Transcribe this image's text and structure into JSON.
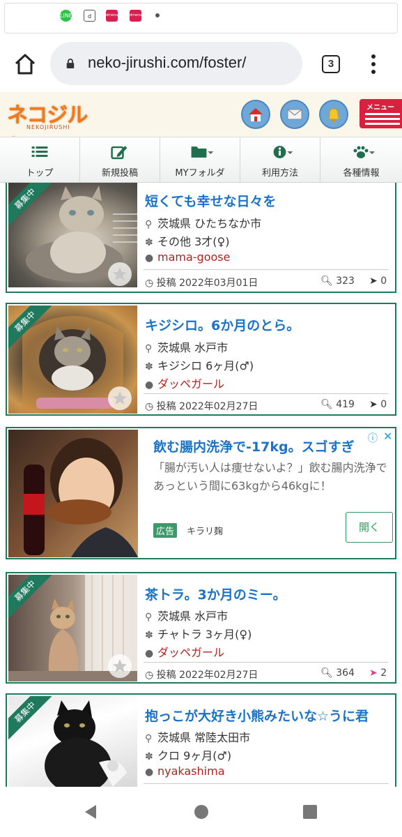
{
  "browser": {
    "url": "neko-jirushi.com/foster/",
    "tab_count": "3"
  },
  "statusbar": {
    "icons": [
      "LINE",
      "d",
      "dmenu",
      "dmenu"
    ]
  },
  "site": {
    "logo_text": "ネコジルシ",
    "logo_sub": "NEKOJIRUSHI",
    "menu_label": "メニュー"
  },
  "nav": {
    "items": [
      {
        "label": "トップ",
        "icon": "list-icon"
      },
      {
        "label": "新規投稿",
        "icon": "edit-icon"
      },
      {
        "label": "MYフォルダ",
        "icon": "folder-icon"
      },
      {
        "label": "利用方法",
        "icon": "info-icon"
      },
      {
        "label": "各種情報",
        "icon": "paw-icon"
      }
    ]
  },
  "listings": [
    {
      "badge": "募集中",
      "title": "短くても幸せな日々を",
      "location": "茨城県 ひたちなか市",
      "breed": "その他 3才(♀)",
      "user": "mama-goose",
      "date": "投稿 2022年03月01日",
      "views": "323",
      "messages": "0"
    },
    {
      "badge": "募集中",
      "title": "キジシロ。6か月のとら。",
      "location": "茨城県 水戸市",
      "breed": "キジシロ 6ヶ月(♂)",
      "user": "ダッペガール",
      "date": "投稿 2022年02月27日",
      "views": "419",
      "messages": "0"
    },
    {
      "badge": "募集中",
      "title": "茶トラ。3か月のミー。",
      "location": "茨城県 水戸市",
      "breed": "チャトラ 3ヶ月(♀)",
      "user": "ダッペガール",
      "date": "投稿 2022年02月27日",
      "views": "364",
      "messages": "2"
    },
    {
      "badge": "募集中",
      "title": "抱っこが大好き小熊みたいな☆うに君",
      "location": "茨城県 常陸太田市",
      "breed": "クロ 9ヶ月(♂)",
      "user": "nyakashima"
    }
  ],
  "ad": {
    "title": "飲む腸内洗浄で-17kg。スゴすぎ",
    "body": "「腸が汚い人は痩せないよ？」飲む腸内洗浄であっという間に63kgから46kgに！",
    "badge": "広告",
    "sponsor": "キラリ麹",
    "cta": "開く"
  },
  "colors": {
    "accent_green": "#1f7a5d",
    "title_blue": "#1a73c8",
    "user_red": "#b52020"
  }
}
